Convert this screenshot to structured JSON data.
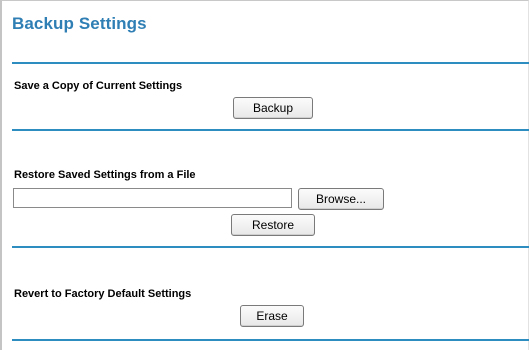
{
  "page": {
    "title": "Backup Settings"
  },
  "sections": {
    "backup": {
      "label": "Save a Copy of Current Settings",
      "button_label": "Backup"
    },
    "restore": {
      "label": "Restore Saved Settings from a File",
      "file_value": "",
      "browse_label": "Browse...",
      "button_label": "Restore"
    },
    "factory": {
      "label": "Revert to Factory Default Settings",
      "button_label": "Erase"
    }
  },
  "colors": {
    "title": "#2f7fb5",
    "divider": "#2d8dc0"
  }
}
